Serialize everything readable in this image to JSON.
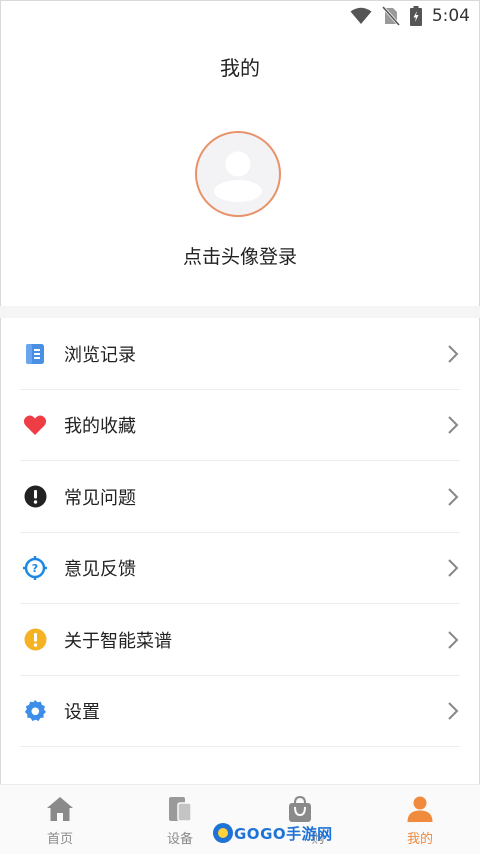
{
  "status_bar": {
    "time": "5:04"
  },
  "header": {
    "title": "我的"
  },
  "profile": {
    "login_prompt": "点击头像登录"
  },
  "menu": {
    "items": [
      {
        "label": "浏览记录",
        "icon": "history-icon",
        "color": "#4a90e2"
      },
      {
        "label": "我的收藏",
        "icon": "heart-icon",
        "color": "#ef3d45"
      },
      {
        "label": "常见问题",
        "icon": "exclamation-icon",
        "color": "#222222"
      },
      {
        "label": "意见反馈",
        "icon": "feedback-target-icon",
        "color": "#1e88e5"
      },
      {
        "label": "关于智能菜谱",
        "icon": "info-alert-icon",
        "color": "#f5b324"
      },
      {
        "label": "设置",
        "icon": "gear-icon",
        "color": "#3d8ee8"
      }
    ]
  },
  "tabbar": {
    "tabs": [
      {
        "label": "首页",
        "icon": "home-icon"
      },
      {
        "label": "设备",
        "icon": "device-icon"
      },
      {
        "label": "购",
        "icon": "shopping-bag-icon"
      },
      {
        "label": "我的",
        "icon": "person-icon",
        "active": true
      }
    ],
    "active_color": "#f08a3c",
    "inactive_color": "#8a8a8a"
  },
  "watermark": {
    "text": "GOGO手游网"
  }
}
